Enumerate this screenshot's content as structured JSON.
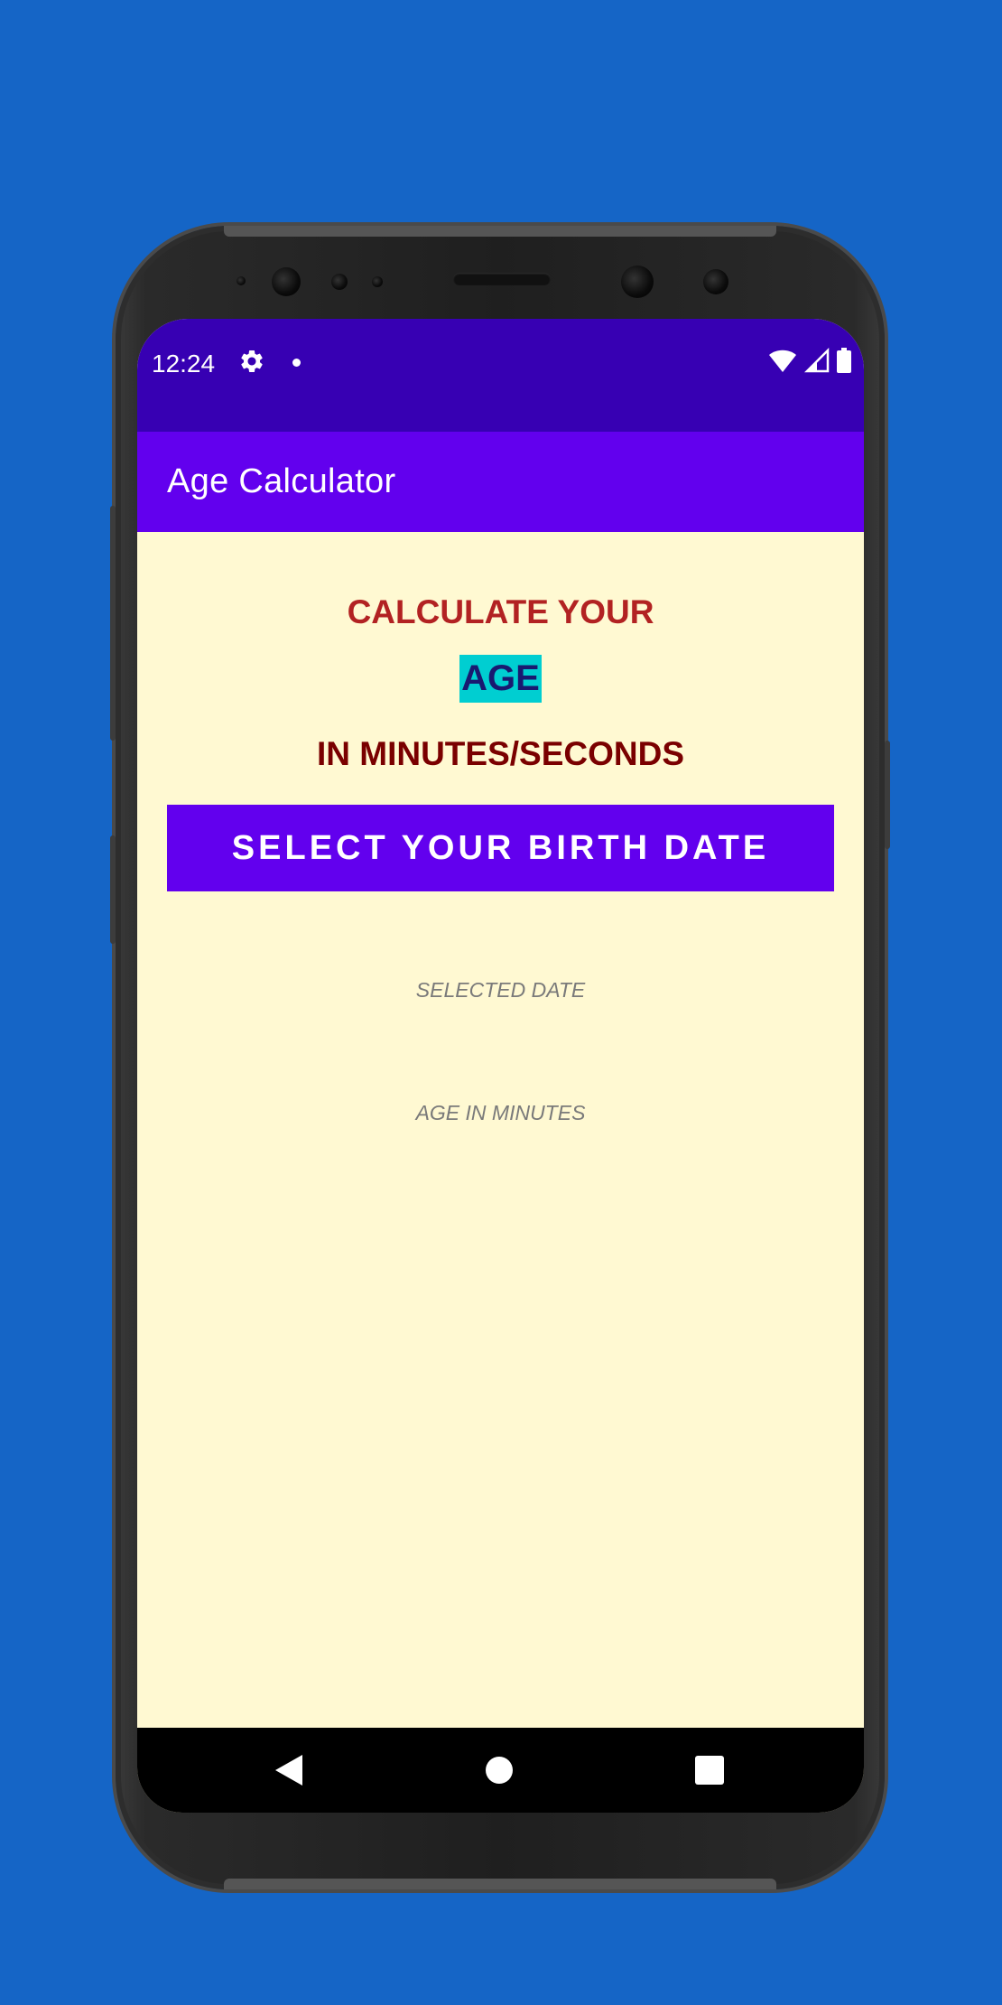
{
  "status_bar": {
    "time": "12:24",
    "icons": [
      "gear-icon",
      "notification-dot-icon",
      "wifi-icon",
      "signal-icon",
      "battery-icon"
    ]
  },
  "app_bar": {
    "title": "Age Calculator"
  },
  "content": {
    "heading_line1": "CALCULATE YOUR",
    "heading_highlight": "AGE",
    "heading_line3": "IN MINUTES/SECONDS",
    "select_button_label": "SELECT YOUR BIRTH DATE",
    "selected_date_placeholder": "SELECTED DATE",
    "age_in_minutes_placeholder": "AGE IN MINUTES"
  },
  "navigation": {
    "buttons": [
      "back-icon",
      "home-icon",
      "recents-icon"
    ]
  },
  "colors": {
    "background": "#1565c6",
    "status_bar": "#3700b3",
    "app_bar": "#6200ee",
    "content_background": "#fff9d2",
    "heading_line1": "#b22222",
    "highlight_background": "#00ced1",
    "highlight_text": "#191970",
    "heading_line3": "#7a0000",
    "button": "#6200ee",
    "placeholder_text": "#7a7a7a"
  }
}
